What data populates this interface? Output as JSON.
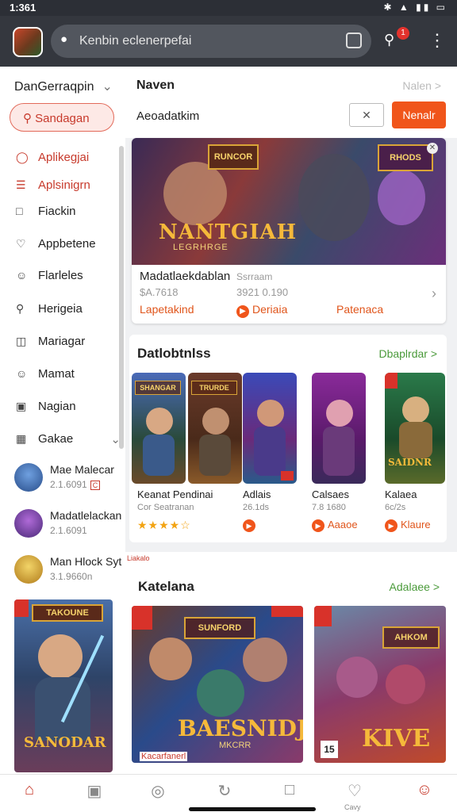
{
  "status": {
    "time": "1:361",
    "right": "✱ ▲ ▮▮ ▭"
  },
  "appbar": {
    "search_placeholder": "Kenbin eclenerpefai",
    "notification_count": "1"
  },
  "header": {
    "dropdown": "DanGerraqpin",
    "tab_title": "Naven",
    "tab_link": "Nalen >",
    "pill": "Sandagan",
    "subtitle": "Aeoadatkim",
    "outline_btn": "✕",
    "primary_btn": "Nenalr"
  },
  "sidebar": {
    "items": [
      {
        "label": "Aplikegjai",
        "icon": "app-icon",
        "active": true
      },
      {
        "label": "Aplsinigrn",
        "icon": "list-icon",
        "active": true
      },
      {
        "label": "Fiackin",
        "icon": "chat-icon",
        "active": false
      },
      {
        "label": "Appbetene",
        "icon": "heart-icon",
        "active": false
      },
      {
        "label": "Flarleles",
        "icon": "user-icon",
        "active": false
      },
      {
        "label": "Herigeia",
        "icon": "search-icon",
        "active": false
      },
      {
        "label": "Mariagar",
        "icon": "file-icon",
        "active": false
      },
      {
        "label": "Mamat",
        "icon": "smile-icon",
        "active": false
      },
      {
        "label": "Nagian",
        "icon": "note-icon",
        "active": false
      },
      {
        "label": "Gakae",
        "icon": "bag-icon",
        "active": false
      }
    ],
    "games": [
      {
        "name": "Mae Malecar",
        "sub": "2.1.6091",
        "tag": "C"
      },
      {
        "name": "Madatlelackan",
        "sub": "2.1.6091",
        "tag": ""
      },
      {
        "name": "Man Hlock Syt",
        "sub": "3.1.9660n",
        "tag": ""
      }
    ],
    "poster_logo": "TAKOUNE",
    "poster_title": "SANODAR"
  },
  "featured": {
    "logo_left": "RUNCOR",
    "logo_right": "RHODS",
    "title_art": "NANTGIAH",
    "subtitle_art": "LEGRHRGE",
    "name": "Madatlaekdablan",
    "meta": "Ssrraam",
    "price": "$A.7618",
    "price2": "3921 0.190",
    "action_a": "Lapetakind",
    "action_b": "Deriaia",
    "action_c": "Patenaca"
  },
  "section2": {
    "title": "Datlobtnlss",
    "link": "Dbaplrdar >",
    "games": [
      {
        "logo": "SHANGAR",
        "name": "Keanat Pendinai",
        "meta": "Cor Seatranan",
        "action": "★★★★☆"
      },
      {
        "logo": "TRURDE",
        "name": "",
        "meta": "",
        "action": ""
      },
      {
        "logo": "",
        "name": "Adlais",
        "meta": "26.1ds",
        "action": ""
      },
      {
        "logo": "",
        "name": "Calsaes",
        "meta": "7.8 1680",
        "action": "Aaaoe"
      },
      {
        "logo": "SAIDNR",
        "name": "Kalaea",
        "meta": "6c/2s",
        "action": "Klaure"
      }
    ]
  },
  "section3": {
    "tag": "Liakalo",
    "title": "Katelana",
    "link": "Adalaee >",
    "posters": [
      {
        "logo": "SUNFORD",
        "title": "BAESNIDJ",
        "sub": "MKCRR",
        "caption": "Kacarfanerl"
      },
      {
        "logo": "AHKOM",
        "title": "KIVE",
        "sub": "",
        "caption": "15"
      }
    ]
  },
  "bottomnav": {
    "items": [
      {
        "icon": "home-icon",
        "label": ""
      },
      {
        "icon": "card-icon",
        "label": ""
      },
      {
        "icon": "compass-icon",
        "label": ""
      },
      {
        "icon": "refresh-icon",
        "label": ""
      },
      {
        "icon": "square-icon",
        "label": ""
      },
      {
        "icon": "heart-icon",
        "label": "Cavy"
      },
      {
        "icon": "user-icon",
        "label": ""
      }
    ]
  },
  "colors": {
    "accent": "#f0551b",
    "primary_red": "#c73a2c",
    "link_green": "#4a9a3a",
    "appbar": "#34373e"
  }
}
